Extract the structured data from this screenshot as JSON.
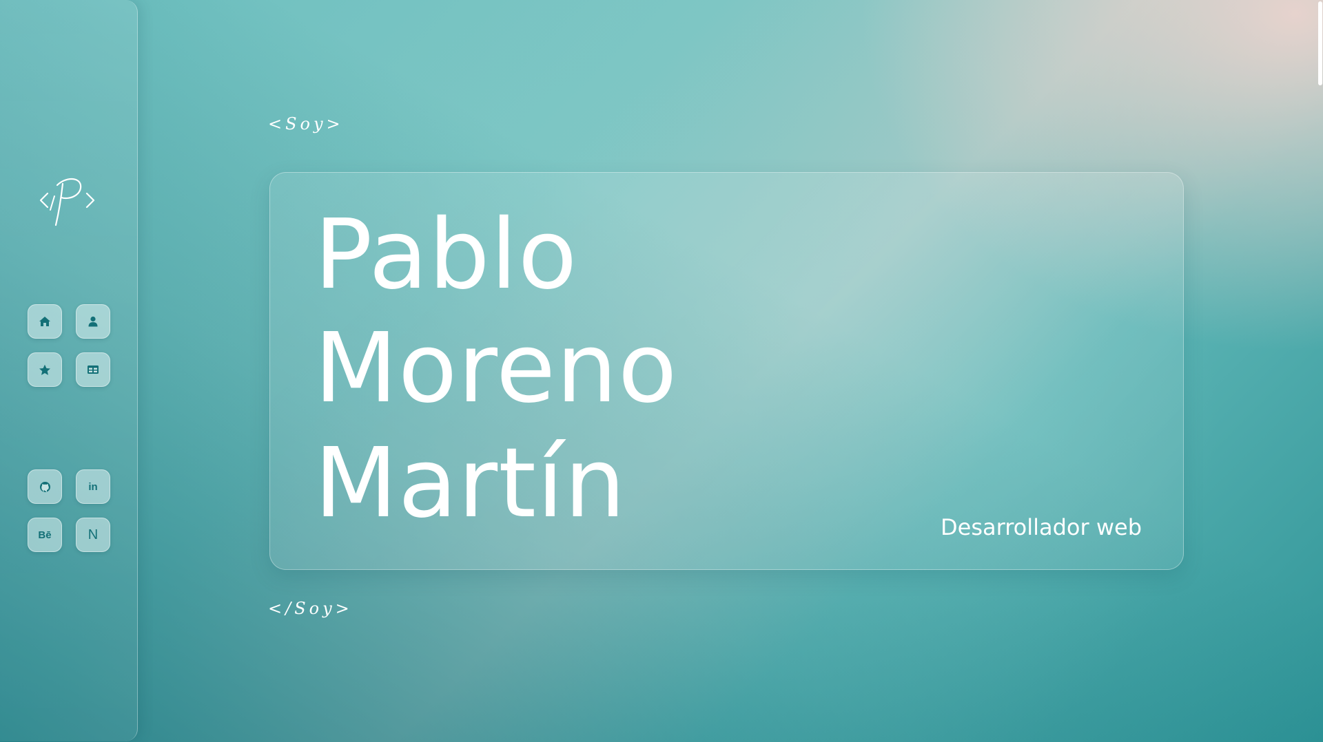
{
  "sidebar": {
    "logo_icon": "p-monogram-logo",
    "nav_items": [
      {
        "name": "home",
        "icon": "home-icon"
      },
      {
        "name": "about",
        "icon": "user-icon"
      },
      {
        "name": "skills",
        "icon": "star-icon"
      },
      {
        "name": "projects",
        "icon": "table-icon"
      }
    ],
    "social_items": [
      {
        "name": "github",
        "icon": "github-icon"
      },
      {
        "name": "linkedin",
        "icon": "linkedin-icon",
        "label": "in"
      },
      {
        "name": "behance",
        "icon": "behance-icon",
        "label": "Bē"
      },
      {
        "name": "notion",
        "icon": "notion-icon",
        "label": "N"
      }
    ]
  },
  "main": {
    "open_tag": "<Soy>",
    "close_tag": "</Soy>",
    "name_lines": [
      "Pablo",
      "Moreno",
      "Martín"
    ],
    "role": "Desarrollador web"
  },
  "colors": {
    "accent": "#137077",
    "text": "#ffffff",
    "icon_bg": "#c8e4e4"
  }
}
